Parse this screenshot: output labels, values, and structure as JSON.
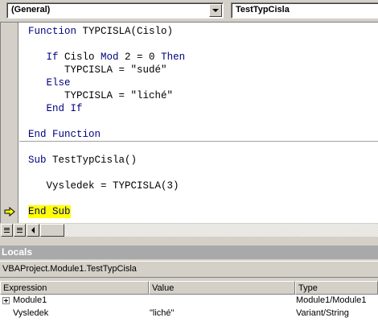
{
  "toolbar": {
    "object_combo": "(General)",
    "procedure_combo": "TestTypCisla"
  },
  "code": {
    "lines": [
      {
        "parts": [
          {
            "t": "Function ",
            "k": true
          },
          {
            "t": "TYPCISLA(Cislo)",
            "k": false
          }
        ]
      },
      {
        "parts": [
          {
            "t": "   If ",
            "k": true
          },
          {
            "t": "Cislo ",
            "k": false
          },
          {
            "t": "Mod ",
            "k": true
          },
          {
            "t": "2 = 0 ",
            "k": false
          },
          {
            "t": "Then",
            "k": true
          }
        ]
      },
      {
        "parts": [
          {
            "t": "      TYPCISLA = \"sudé\"",
            "k": false
          }
        ]
      },
      {
        "parts": [
          {
            "t": "   Else",
            "k": true
          }
        ]
      },
      {
        "parts": [
          {
            "t": "      TYPCISLA = \"liché\"",
            "k": false
          }
        ]
      },
      {
        "parts": [
          {
            "t": "   End If",
            "k": true
          }
        ]
      },
      {
        "parts": [
          {
            "t": "End Function",
            "k": true
          }
        ]
      },
      {
        "parts": [
          {
            "t": "Sub ",
            "k": true
          },
          {
            "t": "TestTypCisla()",
            "k": false
          }
        ]
      },
      {
        "parts": [
          {
            "t": "   Vysledek = TYPCISLA(3)",
            "k": false
          }
        ]
      },
      {
        "parts": [
          {
            "t": "End Sub",
            "k": true
          }
        ]
      }
    ],
    "current_line_index": 9
  },
  "locals": {
    "title": "Locals",
    "context": "VBAProject.Module1.TestTypCisla",
    "columns": [
      "Expression",
      "Value",
      "Type"
    ],
    "rows": [
      {
        "expression": "Module1",
        "value": "",
        "type": "Module1/Module1",
        "expandable": true
      },
      {
        "expression": "Vysledek",
        "value": "\"liché\"",
        "type": "Variant/String",
        "expandable": false
      }
    ]
  },
  "colors": {
    "keyword": "#00007f",
    "highlight": "#ffff00",
    "arrow": "#ffff00",
    "chrome": "#d4d0c8"
  }
}
